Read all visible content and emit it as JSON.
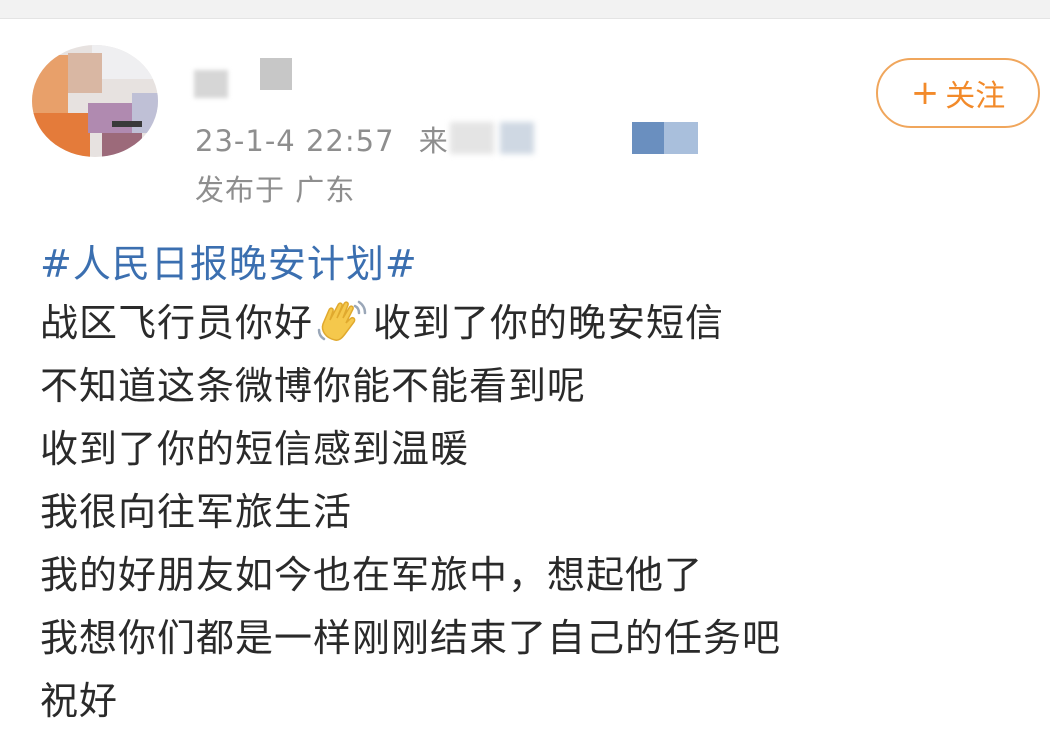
{
  "post": {
    "timestamp": "23-1-4 22:57",
    "source_prefix": "来",
    "location": "发布于 广东",
    "follow_button": {
      "plus": "+",
      "label": "关注"
    },
    "topic": "#人民日报晚安计划#",
    "lines": [
      {
        "before_icon": "战区飞行员你好",
        "icon": "waving-hand-icon",
        "after_icon": "收到了你的晚安短信"
      },
      {
        "text": "不知道这条微博你能不能看到呢"
      },
      {
        "text": "收到了你的短信感到温暖"
      },
      {
        "text": "我很向往军旅生活"
      },
      {
        "text": "我的好朋友如今也在军旅中，想起他了"
      },
      {
        "text": "我想你们都是一样刚刚结束了自己的任务吧"
      },
      {
        "text": "祝好"
      }
    ]
  },
  "colors": {
    "topic_link": "#3b6fb0",
    "follow_accent": "#f28a2a",
    "meta_gray": "#8e8e8e"
  }
}
